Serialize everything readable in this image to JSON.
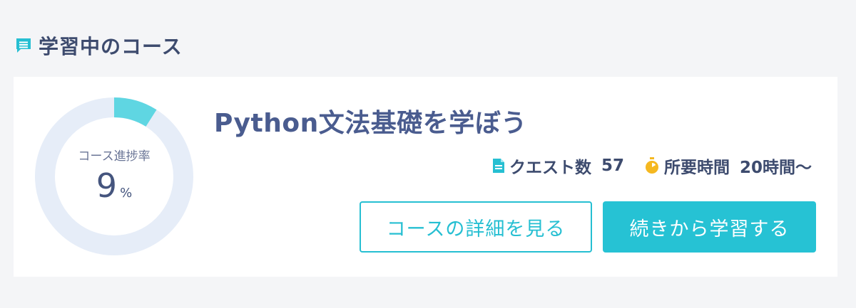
{
  "section": {
    "title": "学習中のコース",
    "icon": "chat-list-icon",
    "icon_color": "#26bfd2"
  },
  "course": {
    "title": "Python文法基礎を学ぼう",
    "progress": {
      "label": "コース進捗率",
      "value": "9",
      "unit": "%",
      "fraction": 0.09
    },
    "quests": {
      "label": "クエスト数",
      "count": "57",
      "icon": "document-icon"
    },
    "time": {
      "label": "所要時間",
      "value": "20時間〜",
      "icon": "stopwatch-icon"
    }
  },
  "buttons": {
    "details": "コースの詳細を見る",
    "continue": "続きから学習する"
  },
  "colors": {
    "accent": "#26c2d4",
    "ring_track": "#e6edf8",
    "ring_fill": "#5fd6e2",
    "text_primary": "#3d4b6e",
    "stopwatch": "#f5b820"
  }
}
